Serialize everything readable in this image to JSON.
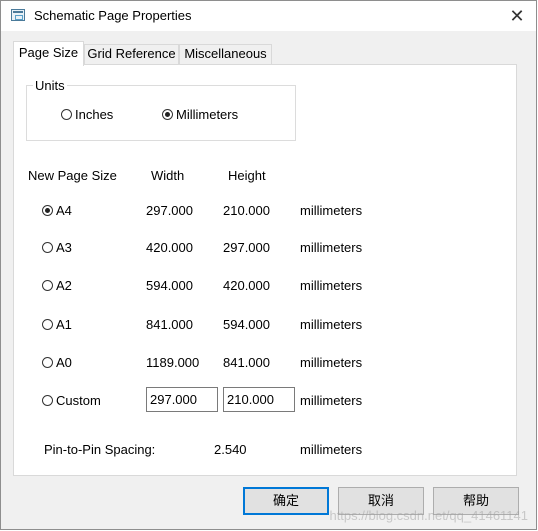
{
  "window": {
    "title": "Schematic Page Properties",
    "close_glyph": "✕"
  },
  "tabs": [
    {
      "label": "Page Size",
      "active": true
    },
    {
      "label": "Grid Reference",
      "active": false
    },
    {
      "label": "Miscellaneous",
      "active": false
    }
  ],
  "units": {
    "legend": "Units",
    "options": [
      {
        "label": "Inches",
        "checked": false
      },
      {
        "label": "Millimeters",
        "checked": true
      }
    ]
  },
  "page_size": {
    "headers": {
      "size": "New Page Size",
      "width": "Width",
      "height": "Height"
    },
    "rows": [
      {
        "label": "A4",
        "width": "297.000",
        "height": "210.000",
        "unit": "millimeters",
        "checked": true
      },
      {
        "label": "A3",
        "width": "420.000",
        "height": "297.000",
        "unit": "millimeters",
        "checked": false
      },
      {
        "label": "A2",
        "width": "594.000",
        "height": "420.000",
        "unit": "millimeters",
        "checked": false
      },
      {
        "label": "A1",
        "width": "841.000",
        "height": "594.000",
        "unit": "millimeters",
        "checked": false
      },
      {
        "label": "A0",
        "width": "1189.000",
        "height": "841.000",
        "unit": "millimeters",
        "checked": false
      }
    ],
    "custom": {
      "label": "Custom",
      "width": "297.000",
      "height": "210.000",
      "unit": "millimeters",
      "checked": false
    }
  },
  "pin_spacing": {
    "label": "Pin-to-Pin Spacing:",
    "value": "2.540",
    "unit": "millimeters"
  },
  "buttons": {
    "ok": "确定",
    "cancel": "取消",
    "help": "帮助"
  },
  "watermark": "https://blog.csdn.net/qq_41461141"
}
